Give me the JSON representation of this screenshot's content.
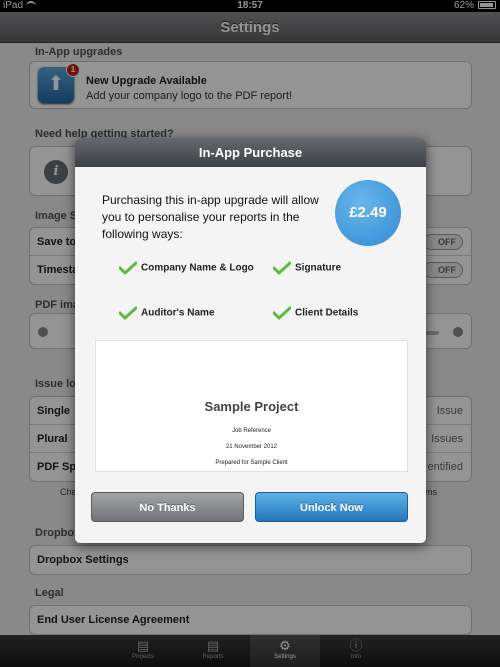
{
  "status_bar": {
    "device": "iPad",
    "time": "18:57",
    "battery": "62%"
  },
  "nav": {
    "title": "Settings"
  },
  "background": {
    "upgrades_header": "In-App upgrades",
    "upgrade_badge": "1",
    "upgrade_title": "New Upgrade Available",
    "upgrade_subtitle": "Add your company logo to the PDF report!",
    "help_header": "Need help getting started?",
    "image_header": "Image S",
    "save_label": "Save to",
    "timestamp_label": "Timesta",
    "toggle_off": "OFF",
    "pdf_header": "PDF ima",
    "issue_header": "Issue lo",
    "rows": [
      {
        "label": "Single",
        "value": "Issue"
      },
      {
        "label": "Plural",
        "value": "Issues"
      },
      {
        "label": "PDF Sp",
        "value": "entified"
      }
    ],
    "hint_left": "Che",
    "hint_right": "ms",
    "dropbox_header": "Dropbox",
    "dropbox_settings": "Dropbox Settings",
    "legal_header": "Legal",
    "eula": "End User License Agreement"
  },
  "tabs": [
    {
      "label": "Projects",
      "icon": "folder-icon"
    },
    {
      "label": "Reports",
      "icon": "report-icon"
    },
    {
      "label": "Settings",
      "icon": "gear-icon"
    },
    {
      "label": "Info",
      "icon": "info-icon"
    }
  ],
  "modal": {
    "title": "In-App Purchase",
    "description": "Purchasing this in-app upgrade will allow you to personalise your reports in the following ways:",
    "price": "£2.49",
    "features": [
      "Company Name & Logo",
      "Signature",
      "Auditor's Name",
      "Client Details"
    ],
    "preview": {
      "title": "Sample Project",
      "job_reference": "Job Reference",
      "date": "21 November 2012",
      "prepared_for": "Prepared for Sample Client"
    },
    "cancel_label": "No Thanks",
    "confirm_label": "Unlock Now"
  }
}
